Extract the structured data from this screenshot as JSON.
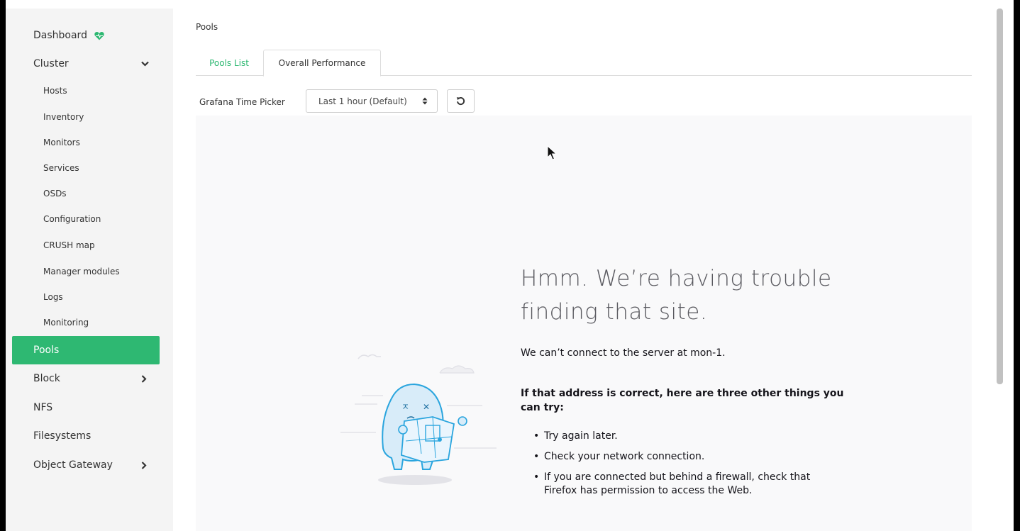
{
  "sidebar": {
    "items": [
      {
        "label": "Dashboard",
        "icon": "heart-pulse-icon"
      },
      {
        "label": "Cluster",
        "icon": "chevron-down-icon"
      },
      {
        "label": "Hosts"
      },
      {
        "label": "Inventory"
      },
      {
        "label": "Monitors"
      },
      {
        "label": "Services"
      },
      {
        "label": "OSDs"
      },
      {
        "label": "Configuration"
      },
      {
        "label": "CRUSH map"
      },
      {
        "label": "Manager modules"
      },
      {
        "label": "Logs"
      },
      {
        "label": "Monitoring"
      },
      {
        "label": "Pools"
      },
      {
        "label": "Block",
        "icon": "chevron-right-icon"
      },
      {
        "label": "NFS"
      },
      {
        "label": "Filesystems"
      },
      {
        "label": "Object Gateway",
        "icon": "chevron-right-icon"
      }
    ],
    "active": "Pools"
  },
  "breadcrumb": "Pools",
  "tabs": [
    {
      "label": "Pools List"
    },
    {
      "label": "Overall Performance"
    }
  ],
  "picker": {
    "label": "Grafana Time Picker",
    "selected": "Last 1 hour (Default)"
  },
  "error": {
    "title": "Hmm. We’re having trouble finding that site.",
    "message": "We can’t connect to the server at mon-1.",
    "subtitle": "If that address is correct, here are three other things you can try:",
    "tips": [
      "Try again later.",
      "Check your network connection.",
      "If you are connected but behind a firewall, check that Firefox has permission to access the Web."
    ]
  },
  "colors": {
    "accent": "#2eb872",
    "heart": "#2eb872",
    "sidebar_bg": "#f4f4f4",
    "iframe_bg": "#f9f9fa"
  }
}
